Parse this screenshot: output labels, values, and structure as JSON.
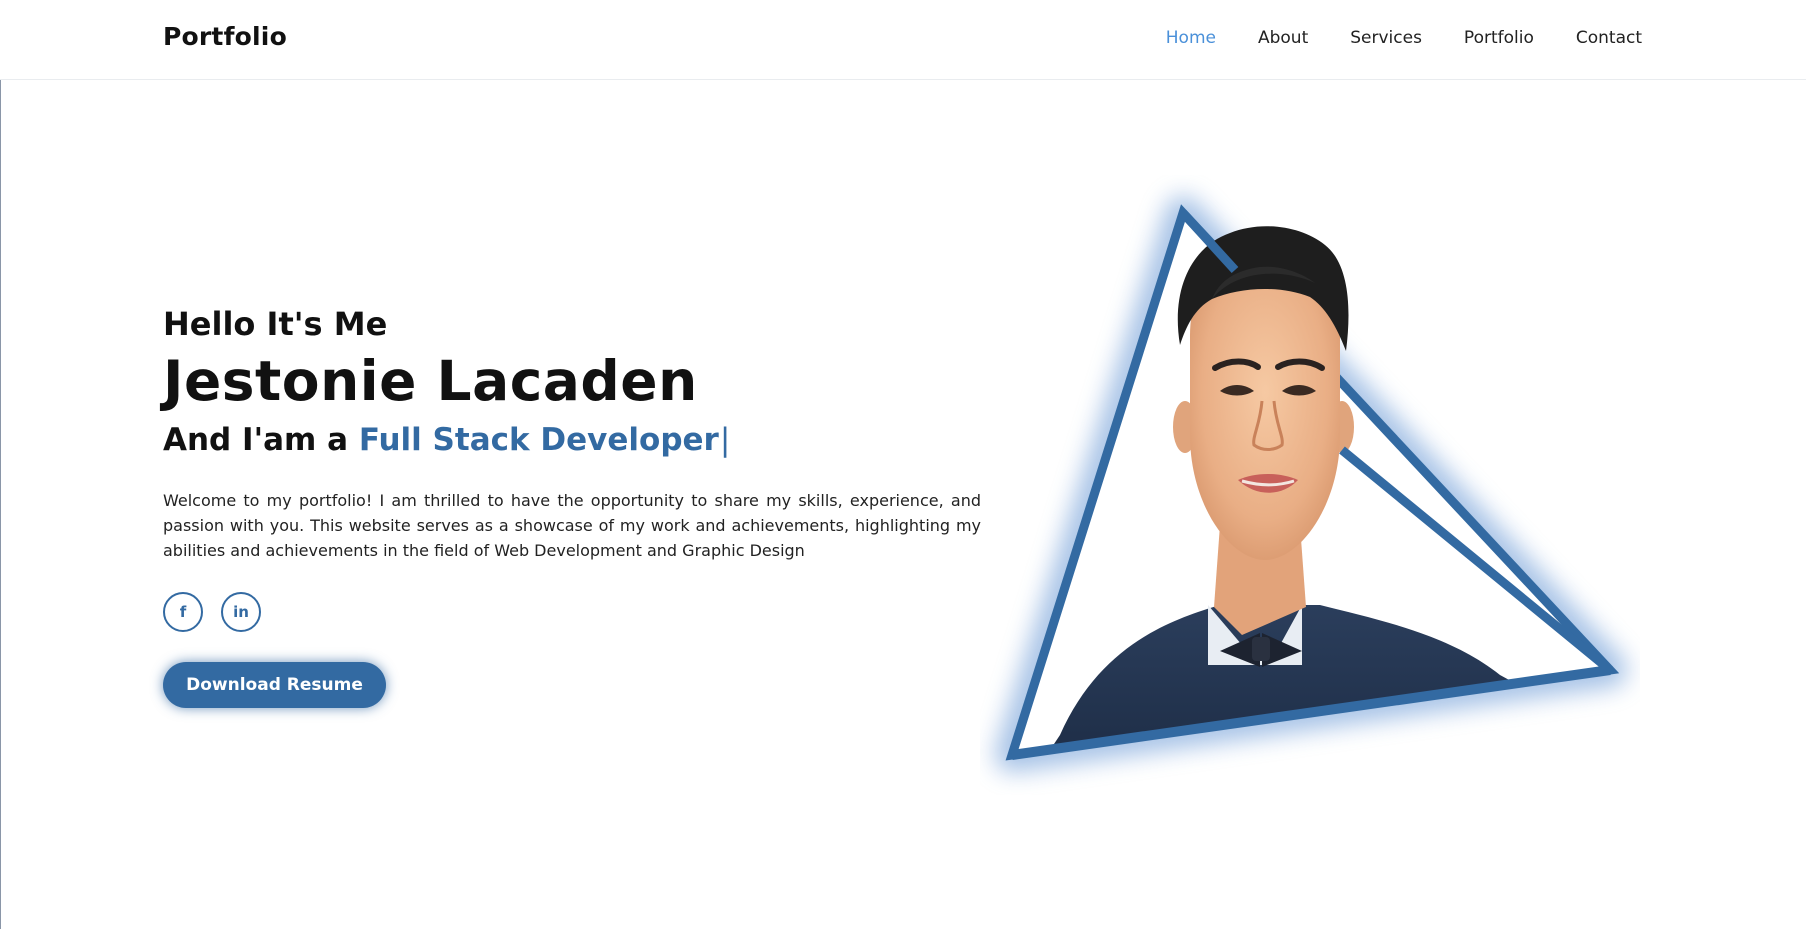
{
  "header": {
    "logo": "Portfolio",
    "nav": [
      {
        "label": "Home",
        "active": true
      },
      {
        "label": "About",
        "active": false
      },
      {
        "label": "Services",
        "active": false
      },
      {
        "label": "Portfolio",
        "active": false
      },
      {
        "label": "Contact",
        "active": false
      }
    ]
  },
  "hero": {
    "greeting": "Hello It's Me",
    "name": "Jestonie Lacaden",
    "role_prefix": "And I'am a",
    "role": "Full Stack Developer",
    "cursor": "|",
    "intro": "Welcome to my portfolio! I am thrilled to have the opportunity to share my skills, experience, and passion with you. This website serves as a showcase of my work and achievements, highlighting my abilities and achievements in the field of Web Development and Graphic Design",
    "socials": [
      {
        "icon": "facebook-icon",
        "glyph": "f"
      },
      {
        "icon": "linkedin-icon",
        "glyph": "in"
      }
    ],
    "download_label": "Download Resume"
  },
  "colors": {
    "accent": "#336aa2",
    "nav_active": "#4a90d9",
    "text": "#111111",
    "background": "#ffffff"
  }
}
